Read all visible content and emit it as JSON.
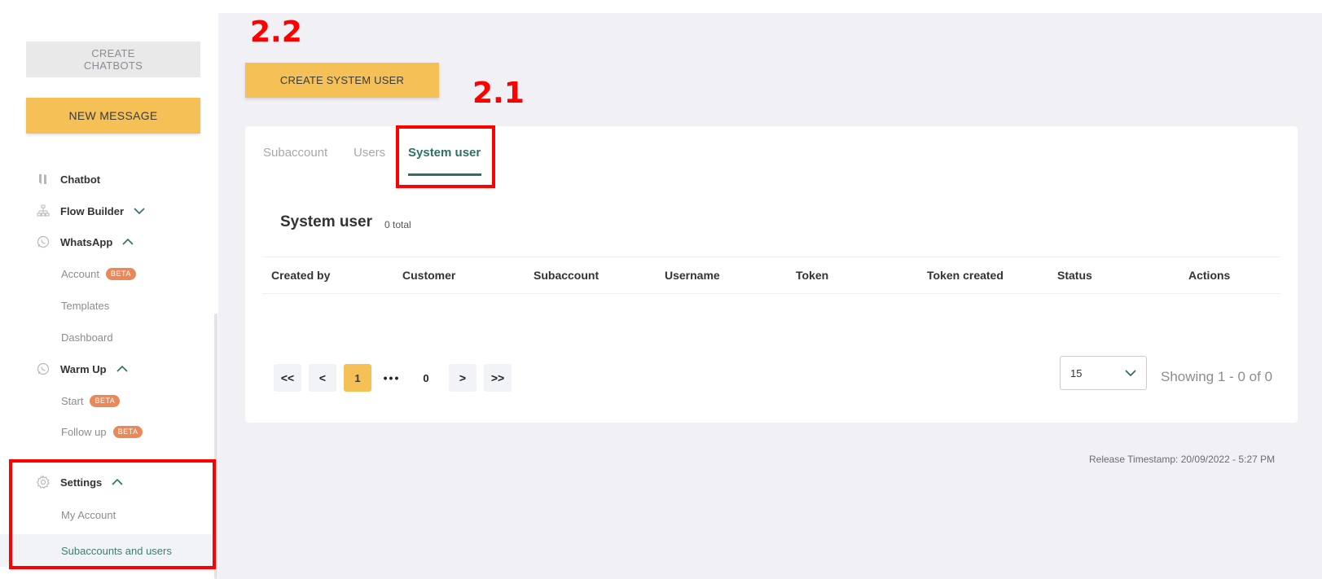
{
  "sidebar": {
    "create_chatbots_label": "CREATE\nCHATBOTS",
    "new_message_label": "NEW MESSAGE",
    "items": {
      "chatbot": "Chatbot",
      "flow_builder": "Flow Builder",
      "whatsapp": "WhatsApp",
      "account": "Account",
      "templates": "Templates",
      "dashboard": "Dashboard",
      "warm_up": "Warm Up",
      "start": "Start",
      "follow_up": "Follow up",
      "settings": "Settings",
      "my_account": "My Account",
      "subaccounts_and_users": "Subaccounts and users"
    },
    "beta_badge": "BETA"
  },
  "annotations": {
    "label_2_2": "2.2",
    "label_2_1": "2.1"
  },
  "main": {
    "create_system_user_label": "CREATE SYSTEM USER",
    "tabs": [
      "Subaccount",
      "Users",
      "System user"
    ],
    "section_title": "System user",
    "section_count": "0 total",
    "columns": [
      "Created by",
      "Customer",
      "Subaccount",
      "Username",
      "Token",
      "Token created",
      "Status",
      "Actions"
    ],
    "pager": {
      "first": "<<",
      "prev": "<",
      "current": "1",
      "dots": "•••",
      "last_page": "0",
      "next": ">",
      "last": ">>"
    },
    "per_page": "15",
    "showing": "Showing 1 - 0 of 0"
  },
  "footer": {
    "release_timestamp": "Release Timestamp: 20/09/2022 - 5:27 PM"
  },
  "colors": {
    "accent_yellow": "#f5c157",
    "teal": "#2f6f68",
    "annotation_red": "#ff0000",
    "badge_orange": "#e9895a"
  }
}
